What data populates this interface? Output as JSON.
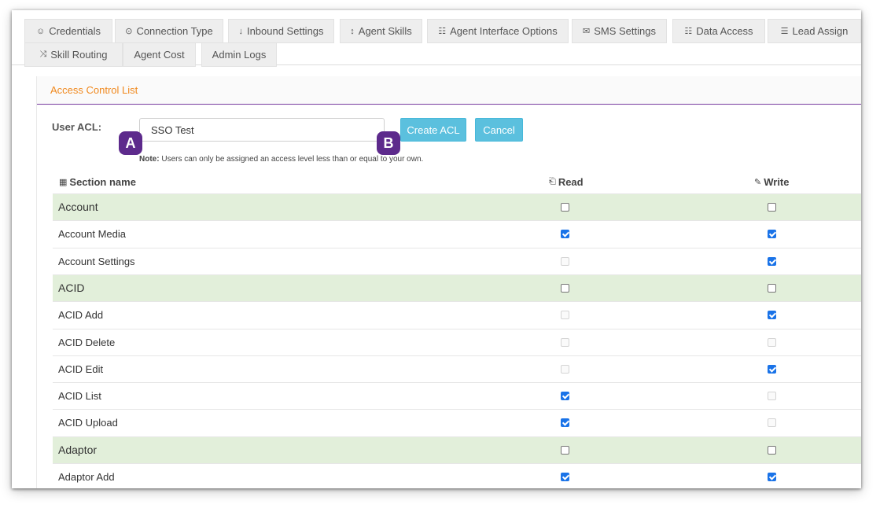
{
  "tabs": [
    {
      "label": "Credentials",
      "icon": "user-icon",
      "glyph": "☺"
    },
    {
      "label": "Connection Type",
      "icon": "lock-icon",
      "glyph": "⊙"
    },
    {
      "label": "Inbound Settings",
      "icon": "arrow-down-icon",
      "glyph": "↓"
    },
    {
      "label": "Agent Skills",
      "icon": "vertical-arrows-icon",
      "glyph": "↕"
    },
    {
      "label": "Agent Interface Options",
      "icon": "grid-icon",
      "glyph": "☷"
    },
    {
      "label": "SMS Settings",
      "icon": "envelope-icon",
      "glyph": "✉"
    },
    {
      "label": "Data Access",
      "icon": "grid-icon",
      "glyph": "☷"
    },
    {
      "label": "Lead Assign",
      "icon": "list-icon",
      "glyph": "☰"
    },
    {
      "label": "Skill Routing",
      "icon": "shuffle-icon",
      "glyph": "⤨"
    },
    {
      "label": "Agent Cost",
      "icon": "",
      "glyph": ""
    },
    {
      "label": "Admin Logs",
      "icon": "",
      "glyph": ""
    }
  ],
  "acl": {
    "section_title": "Access Control List",
    "user_acl_label": "User ACL:",
    "input_value": "SSO Test",
    "create_label": "Create ACL",
    "cancel_label": "Cancel",
    "note_bold": "Note:",
    "note_text": " Users can only be assigned an access level less than or equal to your own."
  },
  "callouts": {
    "a": "A",
    "b": "B"
  },
  "table": {
    "headers": {
      "name": "Section name",
      "name_icon": "▦",
      "read": "Read",
      "read_icon": "⎗",
      "write": "Write",
      "write_icon": "✎"
    },
    "rows": [
      {
        "name": "Account",
        "group": true,
        "read": "unchecked",
        "write": "unchecked"
      },
      {
        "name": "Account Media",
        "group": false,
        "read": "checked",
        "write": "checked"
      },
      {
        "name": "Account Settings",
        "group": false,
        "read": "disabled",
        "write": "checked"
      },
      {
        "name": "ACID",
        "group": true,
        "read": "unchecked",
        "write": "unchecked"
      },
      {
        "name": "ACID Add",
        "group": false,
        "read": "disabled",
        "write": "checked"
      },
      {
        "name": "ACID Delete",
        "group": false,
        "read": "disabled",
        "write": "disabled"
      },
      {
        "name": "ACID Edit",
        "group": false,
        "read": "disabled",
        "write": "checked"
      },
      {
        "name": "ACID List",
        "group": false,
        "read": "checked",
        "write": "disabled"
      },
      {
        "name": "ACID Upload",
        "group": false,
        "read": "checked",
        "write": "disabled"
      },
      {
        "name": "Adaptor",
        "group": true,
        "read": "unchecked",
        "write": "unchecked"
      },
      {
        "name": "Adaptor Add",
        "group": false,
        "read": "checked",
        "write": "checked"
      }
    ]
  },
  "colors": {
    "accent_title": "#f0891e",
    "header_rule": "#7b3fa3",
    "button": "#5bc0de",
    "group_row": "#e2efda",
    "badge": "#5d2a8c",
    "checkbox_checked": "#1a73e8"
  }
}
